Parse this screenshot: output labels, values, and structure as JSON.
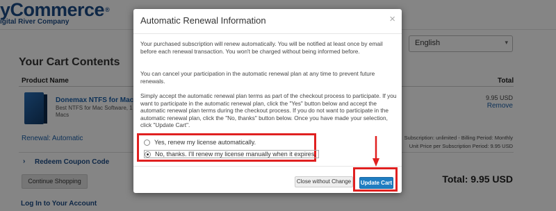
{
  "brand": {
    "logo_text": "yCommerce",
    "logo_tm": "®",
    "logo_subtext": "igital River Company",
    "color": "#1b4b86"
  },
  "language": {
    "selected": "English"
  },
  "cart": {
    "title": "Your Cart Contents",
    "col_product": "Product Name",
    "col_total": "Total",
    "product": {
      "name": "Donemax NTFS for Mac 1",
      "desc_line1": "Best NTFS for Mac Software, 1 M",
      "desc_line2": "Macs",
      "price": "9.95 USD",
      "remove_label": "Remove"
    },
    "renewal_label": "Renewal: Automatic",
    "subscription_info": "Subscription: unlimited - Billing Period: Monthly",
    "unit_price_info": "Unit Price per Subscription Period: 9.95 USD",
    "coupon_label": "Redeem Coupon Code",
    "continue_label": "Continue Shopping",
    "total_label": "Total:  9.95 USD",
    "login_label": "Log In to Your Account"
  },
  "modal": {
    "title": "Automatic Renewal Information",
    "close_glyph": "×",
    "paragraph1": "Your purchased subscription will renew automatically. You will be notified at least once by email before each renewal transaction. You won't be charged without being informed before.",
    "paragraph2": "You can cancel your participation in the automatic renewal plan at any time to prevent future renewals.",
    "paragraph3": "Simply accept the automatic renewal plan terms as part of the checkout process to participate. If you want to participate in the automatic renewal plan, click the \"Yes\" button below and accept the automatic renewal plan terms during the checkout process. If you do not want to participate in the automatic renewal plan, click the \"No, thanks\" button below. Once you have made your selection, click \"Update Cart\".",
    "option_yes": "Yes, renew my license automatically.",
    "option_no": "No, thanks. I'll renew my license manually when it expires.",
    "selected_option": "no",
    "close_button": "Close without Change",
    "update_button": "Update Cart"
  },
  "colors": {
    "highlight_red": "#e02020",
    "primary_blue": "#1f7dc1",
    "link_blue": "#1a5ea8"
  }
}
